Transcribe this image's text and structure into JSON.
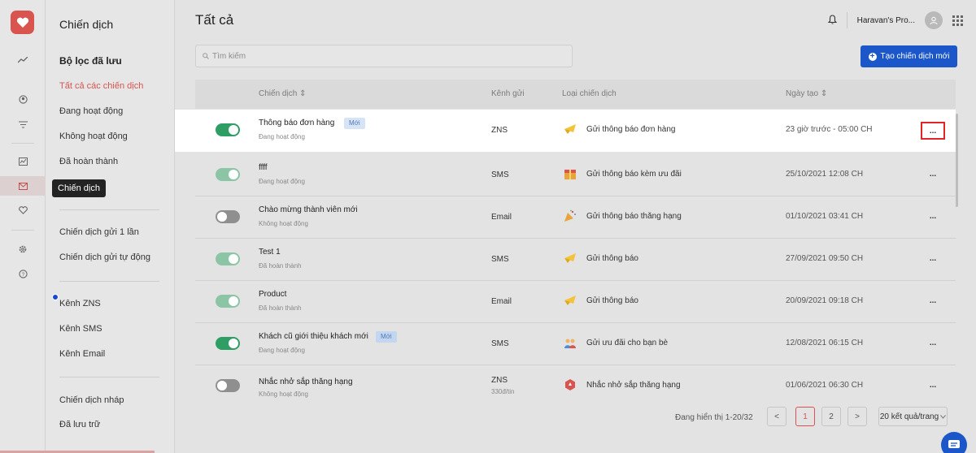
{
  "rail": {
    "icons": [
      "heart-logo-icon",
      "trend-icon",
      "user-circle-icon",
      "filter-icon",
      "report-icon",
      "mail-icon",
      "heart-icon",
      "gear-icon",
      "help-icon"
    ],
    "tooltip": "Chiến dịch"
  },
  "nav": {
    "title": "Chiến dịch",
    "saved_filters": "Bộ lọc đã lưu",
    "items": [
      "Tất cả các chiến dịch",
      "Đang hoạt động",
      "Không hoạt động",
      "Đã hoàn thành",
      "Chiến dịch gửi 1 lần",
      "Chiến dịch gửi tự động",
      "Kênh ZNS",
      "Kênh SMS",
      "Kênh Email",
      "Chiến dịch nháp",
      "Đã lưu trữ"
    ]
  },
  "header": {
    "title": "Tất cả",
    "store_name": "Haravan's Pro...",
    "search_placeholder": "Tìm kiếm",
    "create_button": "Tạo chiến dịch mới"
  },
  "table": {
    "columns": [
      "Chiến dịch",
      "Kênh gửi",
      "Loại chiến dịch",
      "Ngày tạo"
    ],
    "sort_icon": "⇕",
    "more_label": "...",
    "rows": [
      {
        "name": "Thông báo đơn hàng",
        "badge": "Mới",
        "status": "Đang hoạt động",
        "channel": "ZNS",
        "channel_sub": "",
        "type": "Gửi thông báo đơn hàng",
        "type_icon": "megaphone-icon",
        "date": "23 giờ trước - 05:00 CH",
        "toggle": "on"
      },
      {
        "name": "ffff",
        "badge": "",
        "status": "Đang hoạt động",
        "channel": "SMS",
        "channel_sub": "",
        "type": "Gửi thông báo kèm ưu đãi",
        "type_icon": "gift-icon",
        "date": "25/10/2021 12:08 CH",
        "toggle": "on"
      },
      {
        "name": "Chào mừng thành viên mới",
        "badge": "",
        "status": "Không hoạt động",
        "channel": "Email",
        "channel_sub": "",
        "type": "Gửi thông báo thăng hạng",
        "type_icon": "party-icon",
        "date": "01/10/2021 03:41 CH",
        "toggle": "off"
      },
      {
        "name": "Test 1",
        "badge": "",
        "status": "Đã hoàn thành",
        "channel": "SMS",
        "channel_sub": "",
        "type": "Gửi thông báo",
        "type_icon": "megaphone-icon",
        "date": "27/09/2021 09:50 CH",
        "toggle": "on"
      },
      {
        "name": "Product",
        "badge": "",
        "status": "Đã hoàn thành",
        "channel": "Email",
        "channel_sub": "",
        "type": "Gửi thông báo",
        "type_icon": "megaphone-icon",
        "date": "20/09/2021 09:18 CH",
        "toggle": "on"
      },
      {
        "name": "Khách cũ giới thiệu khách mới",
        "badge": "Mới",
        "status": "Đang hoạt động",
        "channel": "SMS",
        "channel_sub": "",
        "type": "Gửi ưu đãi cho bạn bè",
        "type_icon": "friends-icon",
        "date": "12/08/2021 06:15 CH",
        "toggle": "on"
      },
      {
        "name": "Nhắc nhở sắp thăng hạng",
        "badge": "",
        "status": "Không hoạt động",
        "channel": "ZNS",
        "channel_sub": "330đ/tin",
        "type": "Nhắc nhở sắp thăng hạng",
        "type_icon": "rank-icon",
        "date": "01/06/2021 06:30 CH",
        "toggle": "off"
      }
    ]
  },
  "pagination": {
    "info": "Đang hiển thị 1-20/32",
    "prev": "<",
    "pages": [
      "1",
      "2"
    ],
    "next": ">",
    "per_page": "20 kết quả/trang"
  },
  "colors": {
    "accent": "#1b57c9",
    "brand_red": "#d9534f",
    "toggle_on": "#2f9e64"
  }
}
